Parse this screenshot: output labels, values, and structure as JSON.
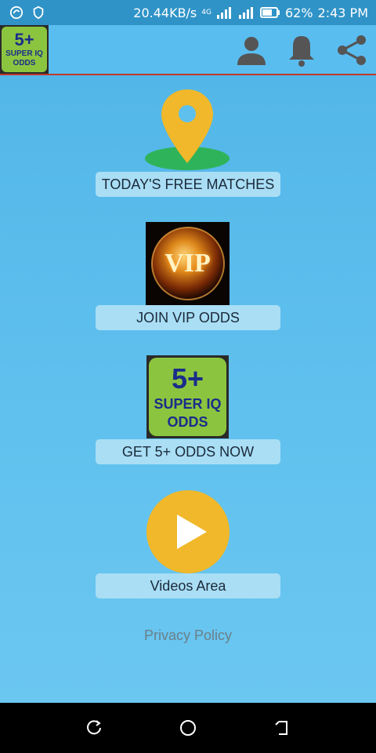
{
  "status_bar": {
    "speed": "20.44KB/s",
    "network": "4G",
    "battery": "62%",
    "time": "2:43 PM"
  },
  "app_bar": {
    "logo": {
      "line1": "5+",
      "line2": "SUPER IQ",
      "line3": "ODDS"
    },
    "actions": [
      "account-icon",
      "bell-icon",
      "share-icon"
    ]
  },
  "menu": {
    "free_matches": "TODAY'S FREE MATCHES",
    "vip": "JOIN VIP ODDS",
    "get_odds": "GET 5+ ODDS NOW",
    "videos": "Videos Area"
  },
  "vip_image": {
    "text": "VIP"
  },
  "odds_image": {
    "line1": "5+",
    "line2": "SUPER IQ",
    "line3": "ODDS"
  },
  "privacy_policy": "Privacy Policy",
  "colors": {
    "background": "#5fc0ee",
    "app_bar": "#59bdf0",
    "status_bar": "#2f93c7",
    "label_bg": "#a9def5",
    "accent_yellow": "#f0b82a",
    "accent_green": "#2fb35a",
    "logo_green": "#8bc53f",
    "logo_blue": "#1a2d8a",
    "divider_red": "#c0392b"
  }
}
